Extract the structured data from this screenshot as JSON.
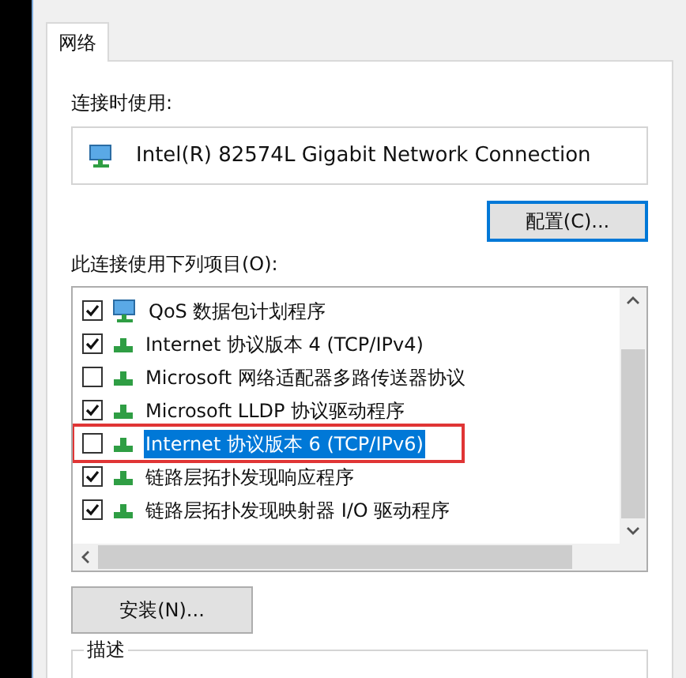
{
  "tabs": [
    {
      "label": "网络",
      "selected": true
    }
  ],
  "connect_using": {
    "label": "连接时使用:",
    "adapter": "Intel(R) 82574L Gigabit Network Connection"
  },
  "configure_button": "配置(C)...",
  "items_label": "此连接使用下列项目(O):",
  "items": [
    {
      "label": "QoS 数据包计划程序",
      "kind": "service",
      "checked": true,
      "selected": false,
      "highlighted": false
    },
    {
      "label": "Internet 协议版本 4 (TCP/IPv4)",
      "kind": "protocol",
      "checked": true,
      "selected": false,
      "highlighted": false
    },
    {
      "label": "Microsoft 网络适配器多路传送器协议",
      "kind": "protocol",
      "checked": false,
      "selected": false,
      "highlighted": false
    },
    {
      "label": "Microsoft LLDP 协议驱动程序",
      "kind": "protocol",
      "checked": true,
      "selected": false,
      "highlighted": false
    },
    {
      "label": "Internet 协议版本 6 (TCP/IPv6)",
      "kind": "protocol",
      "checked": false,
      "selected": true,
      "highlighted": true
    },
    {
      "label": "链路层拓扑发现响应程序",
      "kind": "protocol",
      "checked": true,
      "selected": false,
      "highlighted": false
    },
    {
      "label": "链路层拓扑发现映射器 I/O 驱动程序",
      "kind": "protocol",
      "checked": true,
      "selected": false,
      "highlighted": false
    }
  ],
  "buttons": [
    "安装(N)..."
  ],
  "description_label": "描述"
}
